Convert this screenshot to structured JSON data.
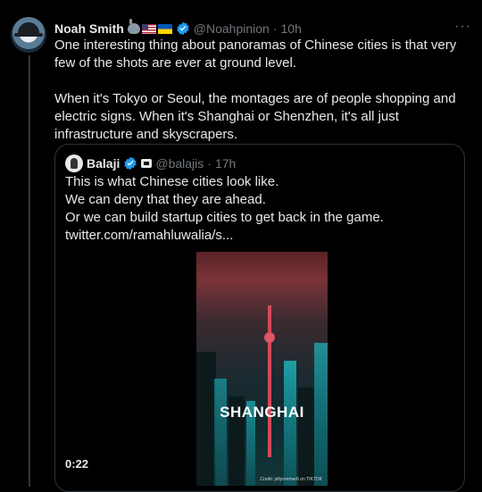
{
  "tweet": {
    "author_name": "Noah Smith",
    "handle": "@Noahpinion",
    "time": "10h",
    "more_label": "···",
    "paragraphs": [
      "One interesting thing about panoramas of Chinese cities is that very few of the shots are ever at ground level.",
      "When it's Tokyo or Seoul, the montages are of people shopping and electric signs. When it's Shanghai or Shenzhen, it's all just infrastructure and skyscrapers."
    ]
  },
  "quote": {
    "author_name": "Balaji",
    "handle": "@balajis",
    "time": "17h",
    "lines": [
      "This is what Chinese cities look like.",
      "We can deny that they are ahead.",
      "Or we can build startup cities to get back in the game.",
      "twitter.com/ramahluwalia/s..."
    ],
    "video": {
      "overlay_text": "SHANGHAI",
      "credit": "Credit: jellyoremar6 on TIKTOK",
      "duration": "0:22"
    }
  },
  "colors": {
    "background": "#000000",
    "text": "#e7e9ea",
    "muted": "#71767b",
    "verified": "#1d9bf0",
    "border": "#2f3336"
  }
}
